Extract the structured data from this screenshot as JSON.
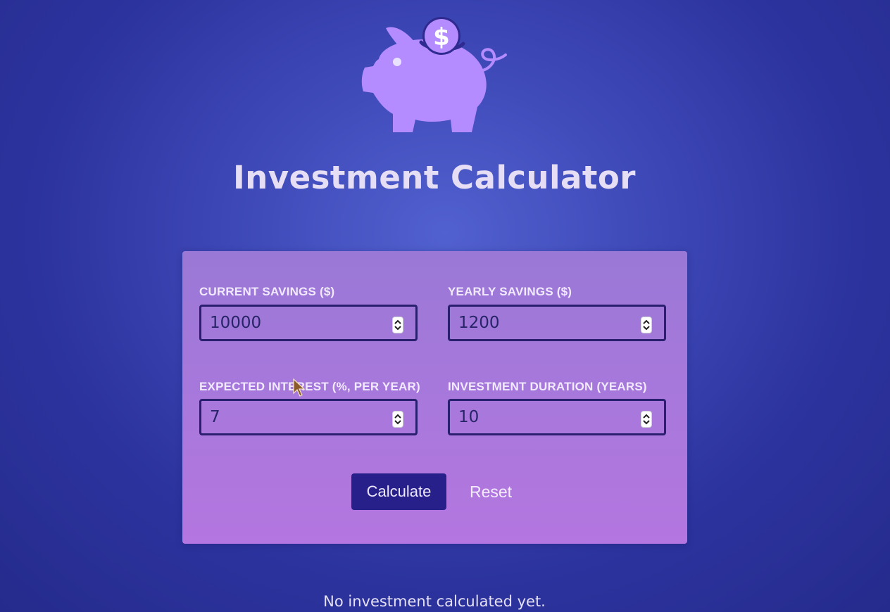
{
  "header": {
    "title": "Investment Calculator",
    "logo_icon": "piggy-bank-dollar-icon"
  },
  "form": {
    "fields": [
      {
        "id": "current-savings",
        "label": "CURRENT SAVINGS ($)",
        "value": "10000"
      },
      {
        "id": "yearly-savings",
        "label": "YEARLY SAVINGS ($)",
        "value": "1200"
      },
      {
        "id": "expected-interest",
        "label": "EXPECTED INTEREST (%, PER YEAR)",
        "value": "7"
      },
      {
        "id": "investment-duration",
        "label": "INVESTMENT DURATION (YEARS)",
        "value": "10"
      }
    ],
    "calculate_label": "Calculate",
    "reset_label": "Reset"
  },
  "results": {
    "empty_message": "No investment calculated yet."
  },
  "colors": {
    "background": "#3d47b6",
    "card": "#a978dc",
    "accent_button": "#28208a",
    "piggy": "#b48cff",
    "input_border": "#2a1f6f"
  }
}
